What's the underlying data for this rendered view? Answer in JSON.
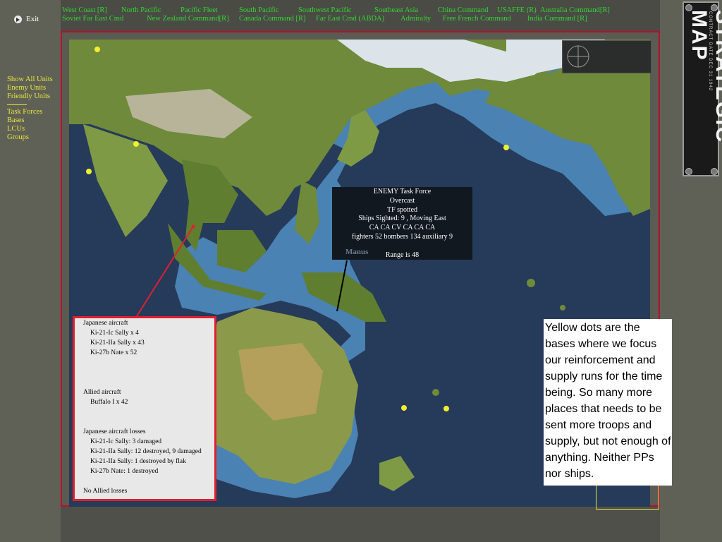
{
  "window": {
    "exit_label": "Exit"
  },
  "hq_menu": {
    "items": [
      "West Coast [R]",
      "North Pacific",
      "Pacific Fleet",
      "South Pacific",
      "Southwest Pacific",
      "Southeast Asia",
      "China Command",
      "USAFFE (R)",
      "Australia Command[R]",
      "Soviet Far East Cmd",
      "New Zealand Command[R]",
      "Canada Command [R]",
      "Far East Cmd (ABDA)",
      "Admiralty",
      "Free French Command",
      "India Command [R]"
    ]
  },
  "side_menu": {
    "show_all": "Show All Units",
    "enemy": "Enemy Units",
    "friendly": "Friendly Units",
    "task_forces": "Task Forces",
    "bases": "Bases",
    "lcus": "LCUs",
    "groups": "Groups"
  },
  "logo": {
    "title": "STRATEGIC MAP",
    "subtitle": "CONTRACT DATE DEC 31 1942"
  },
  "task_force_popup": {
    "title": "ENEMY Task Force",
    "weather": "Overcast",
    "status": "TF spotted",
    "ships": "Ships Sighted: 9 , Moving East",
    "composition": "CA CA CV CA CA CA",
    "aircraft": "fighters 52  bombers 134  auxiliary 9",
    "range": "Range is 48"
  },
  "map_label": "Manus",
  "combat_report": {
    "jp_header": "Japanese aircraft",
    "jp_1": "Ki-21-Ic Sally x 4",
    "jp_2": "Ki-21-IIa Sally x 43",
    "jp_3": "Ki-27b Nate x 52",
    "allied_header": "Allied aircraft",
    "allied_1": "Buffalo I x 42",
    "loss_header": "Japanese aircraft losses",
    "loss_1": "Ki-21-Ic Sally: 3 damaged",
    "loss_2": "Ki-21-IIa Sally: 12 destroyed, 9 damaged",
    "loss_3": "Ki-21-IIa Sally: 1 destroyed by flak",
    "loss_4": "Ki-27b Nate: 1 destroyed",
    "allied_losses": "No Allied losses"
  },
  "annotation": "Yellow dots are the bases where we focus our reinforcement and supply runs for the time being. So many more places that needs to be sent more troops and supply, but not enough of anything. Neither PPs nor ships.",
  "colors": {
    "ocean": "#263a5a",
    "shallow": "#4a82b4",
    "land": "#6e8a3a",
    "snow": "#dce4ea",
    "menu_green": "#33d633",
    "menu_yellow": "#e8e83a",
    "border_red": "#e02030"
  }
}
